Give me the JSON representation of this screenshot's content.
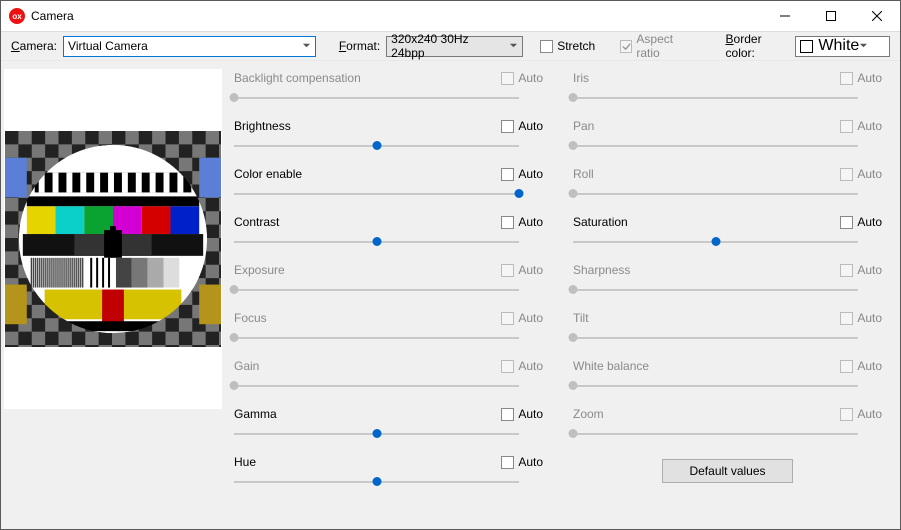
{
  "window": {
    "title": "Camera"
  },
  "toolbar": {
    "camera_label": "Camera:",
    "camera_value": "Virtual Camera",
    "format_label": "Format:",
    "format_value": "320x240 30Hz 24bpp",
    "stretch_label": "Stretch",
    "stretch_checked": false,
    "aspect_label": "Aspect ratio",
    "aspect_checked": true,
    "border_label": "Border color:",
    "border_value": "White",
    "border_hex": "#ffffff"
  },
  "auto_label": "Auto",
  "default_button": "Default values",
  "sliders_left": [
    {
      "id": "backlight",
      "label": "Backlight compensation",
      "enabled": false,
      "value": 0,
      "auto": false
    },
    {
      "id": "brightness",
      "label": "Brightness",
      "enabled": true,
      "value": 50,
      "auto": false
    },
    {
      "id": "colorenable",
      "label": "Color enable",
      "enabled": true,
      "value": 100,
      "auto": false
    },
    {
      "id": "contrast",
      "label": "Contrast",
      "enabled": true,
      "value": 50,
      "auto": false
    },
    {
      "id": "exposure",
      "label": "Exposure",
      "enabled": false,
      "value": 0,
      "auto": false
    },
    {
      "id": "focus",
      "label": "Focus",
      "enabled": false,
      "value": 0,
      "auto": false
    },
    {
      "id": "gain",
      "label": "Gain",
      "enabled": false,
      "value": 0,
      "auto": false
    },
    {
      "id": "gamma",
      "label": "Gamma",
      "enabled": true,
      "value": 50,
      "auto": false
    },
    {
      "id": "hue",
      "label": "Hue",
      "enabled": true,
      "value": 50,
      "auto": false
    }
  ],
  "sliders_right": [
    {
      "id": "iris",
      "label": "Iris",
      "enabled": false,
      "value": 0,
      "auto": false
    },
    {
      "id": "pan",
      "label": "Pan",
      "enabled": false,
      "value": 0,
      "auto": false
    },
    {
      "id": "roll",
      "label": "Roll",
      "enabled": false,
      "value": 0,
      "auto": false
    },
    {
      "id": "saturation",
      "label": "Saturation",
      "enabled": true,
      "value": 50,
      "auto": false
    },
    {
      "id": "sharpness",
      "label": "Sharpness",
      "enabled": false,
      "value": 0,
      "auto": false
    },
    {
      "id": "tilt",
      "label": "Tilt",
      "enabled": false,
      "value": 0,
      "auto": false
    },
    {
      "id": "whitebal",
      "label": "White balance",
      "enabled": false,
      "value": 0,
      "auto": false
    },
    {
      "id": "zoom",
      "label": "Zoom",
      "enabled": false,
      "value": 0,
      "auto": false
    }
  ]
}
